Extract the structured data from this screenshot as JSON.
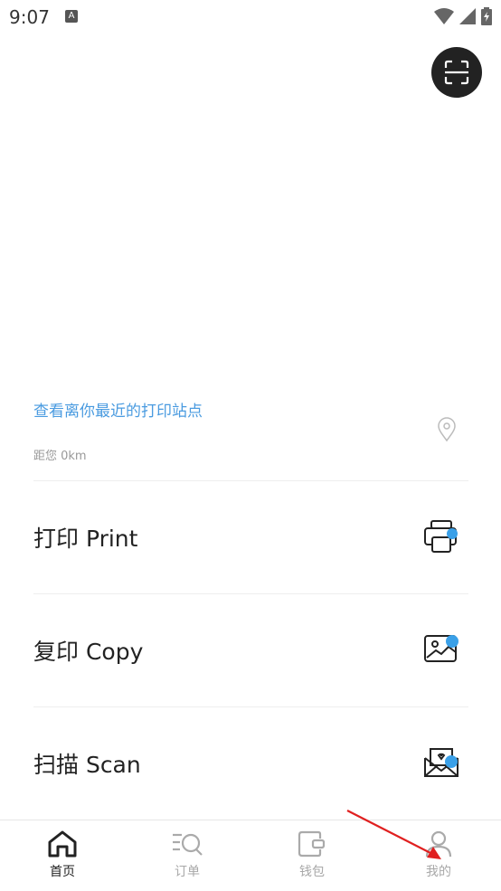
{
  "status_bar": {
    "time": "9:07",
    "a_icon": "A"
  },
  "nearest": {
    "link_text": "查看离你最近的打印站点",
    "distance_text": "距您 0km"
  },
  "actions": [
    {
      "label": "打印 Print",
      "icon": "printer-icon"
    },
    {
      "label": "复印 Copy",
      "icon": "image-icon"
    },
    {
      "label": "扫描 Scan",
      "icon": "scan-envelope-icon"
    }
  ],
  "bottom_nav": {
    "items": [
      {
        "label": "首页",
        "icon": "home-icon",
        "active": true
      },
      {
        "label": "订单",
        "icon": "orders-icon",
        "active": false
      },
      {
        "label": "钱包",
        "icon": "wallet-icon",
        "active": false
      },
      {
        "label": "我的",
        "icon": "user-icon",
        "active": false
      }
    ]
  },
  "colors": {
    "accent": "#4a9be0",
    "dark": "#222222",
    "inactive": "#a8a8a8",
    "annotation": "#e02020"
  }
}
